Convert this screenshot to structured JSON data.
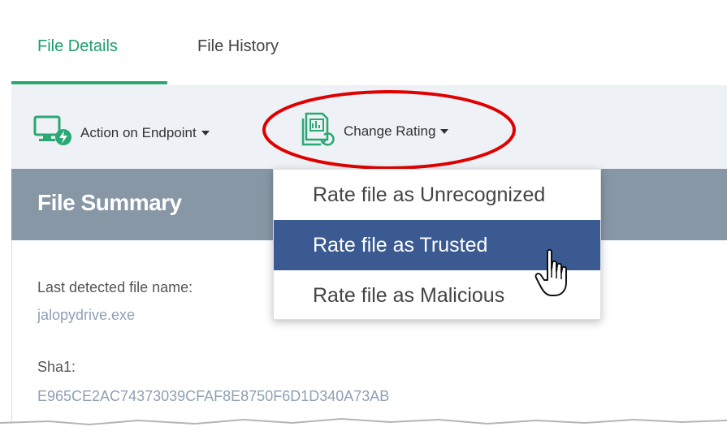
{
  "tabs": [
    {
      "label": "File Details",
      "active": true
    },
    {
      "label": "File History",
      "active": false
    }
  ],
  "toolbar": {
    "action_label": "Action on Endpoint",
    "rating_label": "Change Rating"
  },
  "summary": {
    "title": "File Summary",
    "last_detected_label": "Last detected file name:",
    "last_detected_value": "jalopydrive.exe",
    "sha1_label": "Sha1:",
    "sha1_value": "E965CE2AC74373039CFAF8E8750F6D1D340A73AB"
  },
  "dropdown": {
    "items": [
      {
        "label": "Rate file as Unrecognized",
        "selected": false
      },
      {
        "label": "Rate file as Trusted",
        "selected": true
      },
      {
        "label": "Rate file as Malicious",
        "selected": false
      }
    ]
  },
  "colors": {
    "accent": "#2aa874",
    "toolbar_bg": "#eef1f5",
    "header_bg": "#8797a6",
    "selected_bg": "#3b5a91",
    "highlight": "#e00000"
  }
}
